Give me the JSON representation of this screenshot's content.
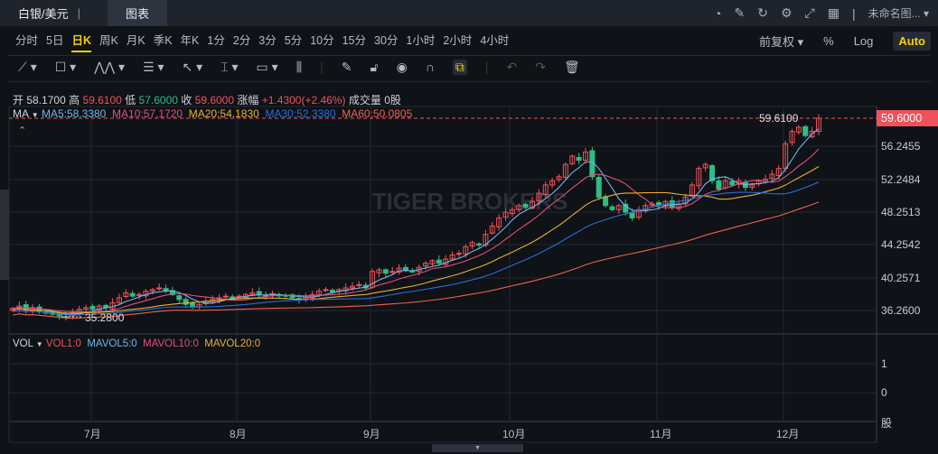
{
  "topbar": {
    "symbol_tab": "白银/美元",
    "chart_tab": "图表",
    "layout_name": "未命名图...",
    "icons": [
      "speed-icon",
      "edit-icon",
      "refresh-icon",
      "settings-icon",
      "fullscreen-icon",
      "grid-icon"
    ]
  },
  "intervals": [
    "分时",
    "5日",
    "日K",
    "周K",
    "月K",
    "季K",
    "年K",
    "1分",
    "2分",
    "3分",
    "5分",
    "10分",
    "15分",
    "30分",
    "1小时",
    "2小时",
    "4小时"
  ],
  "active_interval": "日K",
  "controls": {
    "adjust": "前复权",
    "percent": "%",
    "log": "Log",
    "auto": "Auto"
  },
  "info": {
    "open_label": "开",
    "open": "58.1700",
    "high_label": "高",
    "high": "59.6100",
    "low_label": "低",
    "low": "57.6000",
    "close_label": "收",
    "close": "59.6000",
    "change_label": "涨幅",
    "change": "+1.4300(+2.46%)",
    "volume_label": "成交量",
    "volume": "0股"
  },
  "ma": {
    "label": "MA",
    "ma5": "MA5:58.3380",
    "ma10": "MA10:57.1720",
    "ma20": "MA20:54.1830",
    "ma30": "MA30:52.3380",
    "ma60": "MA60:50.0805"
  },
  "vol": {
    "label": "VOL",
    "vol1": "VOL1:0",
    "mavol5": "MAVOL5:0",
    "mavol10": "MAVOL10:0",
    "mavol20": "MAVOL20:0",
    "axis": [
      "1",
      "0",
      "股"
    ]
  },
  "watermark": "TIGER BROKERS",
  "colors": {
    "up": "#f0525a",
    "down": "#2ebd85",
    "ma5": "#6fb8e8",
    "ma10": "#e0507a",
    "ma20": "#e8b030",
    "ma30": "#2a6fd8",
    "ma60": "#f06050"
  },
  "chart_data": {
    "type": "candlestick",
    "price_axis": [
      "56.2455",
      "52.2484",
      "48.2513",
      "44.2542",
      "40.2571",
      "36.2600"
    ],
    "current_price": "59.6000",
    "high_marker": "59.6100",
    "low_marker": "35.2800",
    "months": [
      "7月",
      "8月",
      "9月",
      "10月",
      "11月",
      "12月"
    ],
    "closes": [
      36.5,
      36.8,
      36.3,
      36.6,
      36.2,
      36.0,
      35.8,
      35.6,
      35.5,
      36.0,
      36.4,
      36.6,
      36.4,
      36.8,
      36.6,
      37.2,
      37.8,
      38.4,
      38.0,
      38.2,
      38.6,
      38.8,
      39.0,
      38.6,
      38.2,
      37.6,
      37.0,
      36.8,
      37.0,
      37.4,
      37.6,
      37.8,
      38.0,
      37.9,
      38.0,
      38.2,
      38.4,
      38.2,
      38.0,
      38.3,
      38.1,
      38.0,
      37.8,
      37.6,
      37.9,
      38.2,
      38.6,
      38.8,
      38.5,
      38.8,
      39.0,
      39.2,
      39.4,
      39.0,
      41.0,
      41.2,
      40.8,
      41.0,
      41.4,
      41.2,
      41.0,
      41.5,
      42.0,
      42.3,
      42.0,
      42.5,
      43.0,
      43.2,
      44.0,
      44.5,
      44.2,
      45.5,
      46.5,
      47.5,
      48.2,
      48.5,
      49.0,
      48.8,
      49.5,
      50.5,
      51.5,
      52.0,
      52.5,
      54.0,
      55.0,
      54.5,
      55.5,
      52.5,
      50.0,
      49.0,
      48.5,
      49.0,
      48.2,
      47.5,
      48.5,
      49.0,
      49.2,
      49.0,
      49.5,
      48.8,
      49.2,
      50.0,
      51.5,
      53.5,
      54.0,
      52.0,
      51.0,
      52.0,
      51.5,
      52.0,
      51.2,
      51.5,
      52.0,
      52.2,
      52.8,
      53.5,
      56.5,
      58.0,
      58.5,
      57.5,
      58.0,
      59.6
    ]
  }
}
